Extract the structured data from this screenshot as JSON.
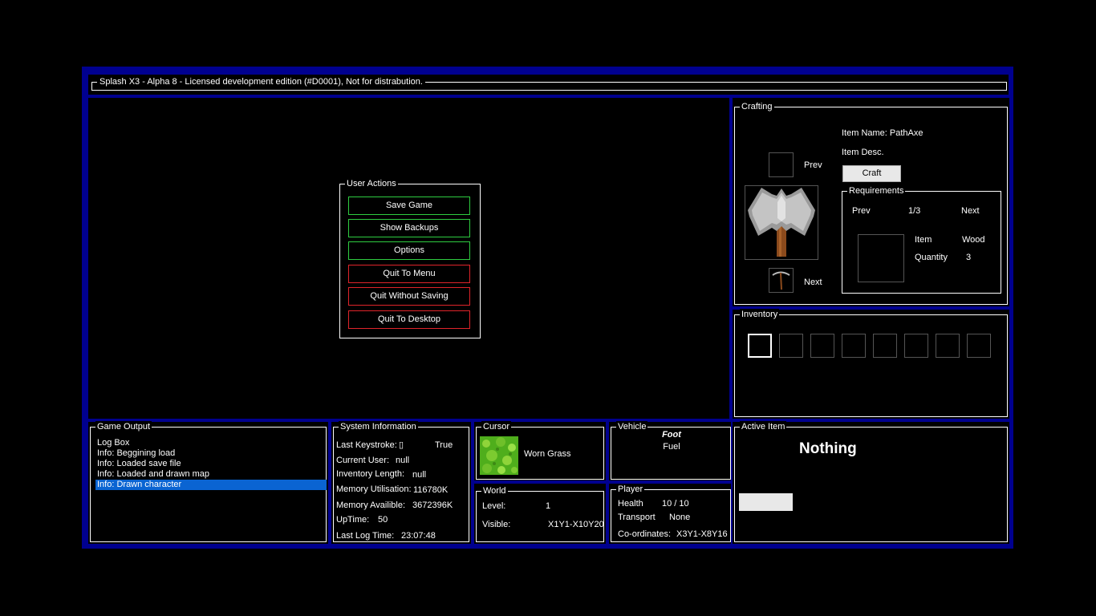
{
  "title_bar": {
    "text": "Splash X3 - Alpha 8 - Licensed development edition (#D0001), Not for distrabution."
  },
  "user_actions": {
    "legend": "User Actions",
    "buttons": [
      {
        "label": "Save Game",
        "color": "#2ecc40"
      },
      {
        "label": "Show Backups",
        "color": "#2ecc40"
      },
      {
        "label": "Options",
        "color": "#2ecc40"
      },
      {
        "label": "Quit To Menu",
        "color": "#e0242a"
      },
      {
        "label": "Quit Without Saving",
        "color": "#e0242a"
      },
      {
        "label": "Quit To Desktop",
        "color": "#e0242a"
      }
    ]
  },
  "crafting": {
    "legend": "Crafting",
    "prev_label": "Prev",
    "next_label": "Next",
    "item_name": "Item Name: PathAxe",
    "item_desc": "Item Desc.",
    "craft_button": "Craft",
    "main_icon": "double-axe-icon",
    "next_icon": "pickaxe-icon",
    "requirements": {
      "legend": "Requirements",
      "prev_label": "Prev",
      "page": "1/3",
      "next_label": "Next",
      "item_label": "Item",
      "item_value": "Wood",
      "quantity_label": "Quantity",
      "quantity_value": "3"
    }
  },
  "inventory": {
    "legend": "Inventory",
    "slot_count": 8,
    "selected_slot": 1
  },
  "game_output": {
    "legend": "Game Output",
    "lines": [
      {
        "text": "Log Box"
      },
      {
        "text": "Info: Beggining load"
      },
      {
        "text": "Info: Loaded save file"
      },
      {
        "text": "Info: Loaded and drawn map"
      },
      {
        "text": "Info: Drawn character",
        "selected": true
      }
    ],
    "selection_color": "#0a64d2"
  },
  "system_info": {
    "legend": "System Information",
    "last_keystroke_label": "Last Keystroke:",
    "last_keystroke_glyph": "▯",
    "last_keystroke_value": "True",
    "current_user_label": "Current User:",
    "current_user_value": "null",
    "inventory_length_label": "Inventory Length:",
    "inventory_length_value": "null",
    "memory_util_label": "Memory Utilisation:",
    "memory_util_value": "116780K",
    "memory_avail_label": "Memory Availible:",
    "memory_avail_value": "3672396K",
    "uptime_label": "UpTime:",
    "uptime_value": "50",
    "last_log_label": "Last Log Time:",
    "last_log_value": "23:07:48"
  },
  "cursor": {
    "legend": "Cursor",
    "tile_name": "Worn Grass",
    "tile_icon": "grass-tile-icon"
  },
  "world": {
    "legend": "World",
    "level_label": "Level:",
    "level_value": "1",
    "visible_label": "Visible:",
    "visible_value": "X1Y1-X10Y20"
  },
  "vehicle": {
    "legend": "Vehicle",
    "name": "Foot",
    "fuel_label": "Fuel"
  },
  "player": {
    "legend": "Player",
    "health_label": "Health",
    "health_value": "10 / 10",
    "transport_label": "Transport",
    "transport_value": "None",
    "coords_label": "Co-ordinates:",
    "coords_value": "X3Y1-X8Y16"
  },
  "active_item": {
    "legend": "Active Item",
    "name": "Nothing"
  },
  "colors": {
    "frame": "#00008f",
    "panel": "#000000",
    "text": "#ffffff",
    "button_light": "#e8e8e8"
  }
}
